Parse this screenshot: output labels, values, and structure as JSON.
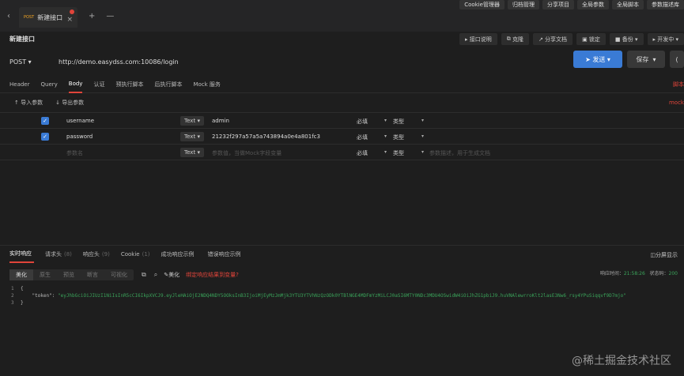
{
  "toolbar": {
    "buttons": [
      "Cookie管理器",
      "归档管理",
      "分享项目",
      "全局参数",
      "全局脚本",
      "参数描述库"
    ]
  },
  "tab": {
    "method": "POST",
    "title": "新建接口"
  },
  "page": {
    "title": "新建接口"
  },
  "actions": [
    "接口说明",
    "克隆",
    "分享文档",
    "锁定",
    "备份",
    "开发中"
  ],
  "request": {
    "method": "POST",
    "url": "http://demo.easydss.com:10086/login",
    "send": "发送",
    "save": "保存"
  },
  "reqtabs": [
    "Header",
    "Query",
    "Body",
    "认证",
    "预执行脚本",
    "后执行脚本",
    "Mock 服务"
  ],
  "reqtabs_right": "脚本",
  "import": {
    "import_label": "导入参数",
    "export_label": "导出参数",
    "right": "mock"
  },
  "params": [
    {
      "key": "username",
      "type": "Text",
      "value": "admin",
      "required": "必填",
      "kind": "类型",
      "desc": ""
    },
    {
      "key": "password",
      "type": "Text",
      "value": "21232f297a57a5a743894a0e4a801fc3",
      "required": "必填",
      "kind": "类型",
      "desc": ""
    }
  ],
  "param_placeholder": {
    "key": "参数名",
    "type": "Text",
    "value": "参数值，当做Mock字段变量",
    "required": "必填",
    "kind": "类型",
    "desc": "参数描述，用于生成文档"
  },
  "response": {
    "tabs": [
      {
        "label": "实时响应",
        "count": ""
      },
      {
        "label": "请求头",
        "count": "(8)"
      },
      {
        "label": "响应头",
        "count": "(9)"
      },
      {
        "label": "Cookie",
        "count": "(1)"
      },
      {
        "label": "成功响应示例",
        "count": ""
      },
      {
        "label": "错误响应示例",
        "count": ""
      }
    ],
    "split": "分屏显示",
    "views": [
      "美化",
      "原生",
      "预览",
      "断言",
      "可视化"
    ],
    "beautify": "美化",
    "link": "绑定响应结果到变量?",
    "time_label": "响应时间：",
    "time_value": "21:58:26",
    "status_label": "状态码：",
    "status_value": "200",
    "code_lines": [
      {
        "n": "1",
        "text": "{"
      },
      {
        "n": "2",
        "key": "\"token\"",
        "sep": ": ",
        "val": "\"eyJhbGciOiJIUzI1NiIsInR5cCI6IkpXVCJ9.eyJleHAiOjE2NDQ4NDY5OOksInB3IjoiMjEyMzJmMjk3YTU3YTVhNzQzODk0YTBlNGE4MDFmYzMiLCJ0aSI6MTY0NDc3MDU4OSwidW4iOiJhZG1pbiJ9.huVNAlewrroKlt2lasE3Nw6_rsy4YPuSiqqvf9D7mjo\""
      },
      {
        "n": "3",
        "text": "}"
      }
    ]
  },
  "watermark": "@稀土掘金技术社区"
}
